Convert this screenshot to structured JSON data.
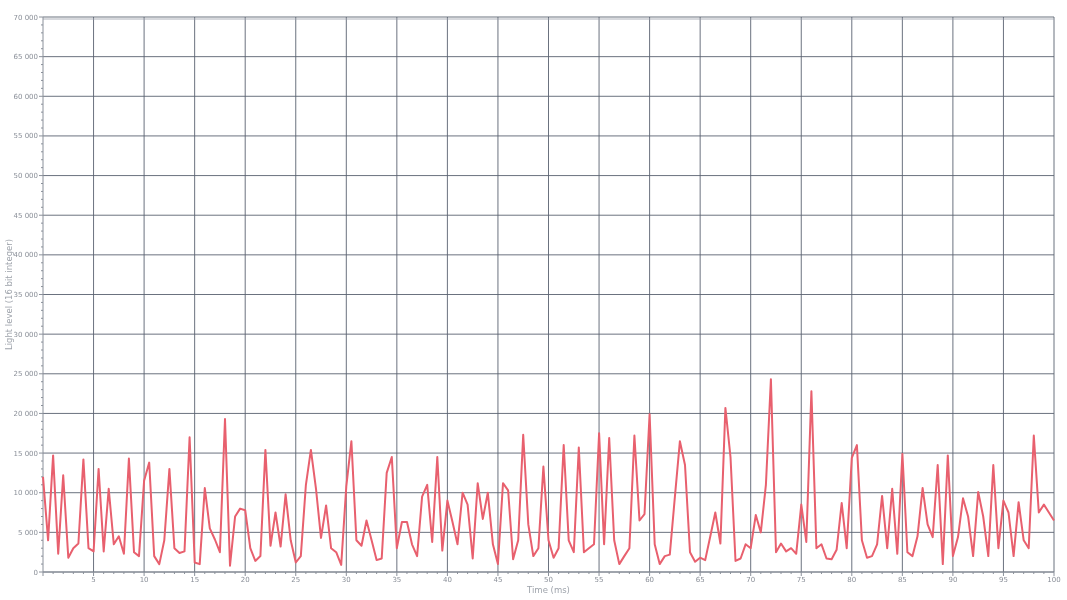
{
  "chart": {
    "chart_data": {
      "type": "line",
      "xlabel": "Time (ms)",
      "ylabel": "Light level (16 bit integer)",
      "xlim": [
        0,
        100
      ],
      "ylim": [
        0,
        70000
      ],
      "xticks": [
        5,
        10,
        15,
        20,
        25,
        30,
        35,
        40,
        45,
        50,
        55,
        60,
        65,
        70,
        75,
        80,
        85,
        90,
        95,
        100
      ],
      "yticks": [
        {
          "value": 0,
          "label": "0"
        },
        {
          "value": 5000,
          "label": "5 000"
        },
        {
          "value": 10000,
          "label": "10 000"
        },
        {
          "value": 15000,
          "label": "15 000"
        },
        {
          "value": 20000,
          "label": "20 000"
        },
        {
          "value": 25000,
          "label": "25 000"
        },
        {
          "value": 30000,
          "label": "30 000"
        },
        {
          "value": 35000,
          "label": "35 000"
        },
        {
          "value": 40000,
          "label": "40 000"
        },
        {
          "value": 45000,
          "label": "45 000"
        },
        {
          "value": 50000,
          "label": "50 000"
        },
        {
          "value": 55000,
          "label": "55 000"
        },
        {
          "value": 60000,
          "label": "60 000"
        },
        {
          "value": 65000,
          "label": "65 000"
        },
        {
          "value": 70000,
          "label": "70 000"
        }
      ],
      "x": [
        0,
        0.5,
        1,
        1.5,
        2,
        2.5,
        3,
        3.5,
        4,
        4.5,
        5,
        5.5,
        6,
        6.5,
        7,
        7.5,
        8,
        8.5,
        9,
        9.5,
        10,
        10.5,
        11,
        11.5,
        12,
        12.5,
        13,
        13.5,
        14,
        14.5,
        15,
        15.5,
        16,
        16.5,
        17,
        17.5,
        18,
        18.5,
        19,
        19.5,
        20,
        20.5,
        21,
        21.5,
        22,
        22.5,
        23,
        23.5,
        24,
        24.5,
        25,
        25.5,
        26,
        26.5,
        27,
        27.5,
        28,
        28.5,
        29,
        29.5,
        30,
        30.5,
        31,
        31.5,
        32,
        32.5,
        33,
        33.5,
        34,
        34.5,
        35,
        35.5,
        36,
        36.5,
        37,
        37.5,
        38,
        38.5,
        39,
        39.5,
        40,
        40.5,
        41,
        41.5,
        42,
        42.5,
        43,
        43.5,
        44,
        44.5,
        45,
        45.5,
        46,
        46.5,
        47,
        47.5,
        48,
        48.5,
        49,
        49.5,
        50,
        50.5,
        51,
        51.5,
        52,
        52.5,
        53,
        53.5,
        54,
        54.5,
        55,
        55.5,
        56,
        56.5,
        57,
        57.5,
        58,
        58.5,
        59,
        59.5,
        60,
        60.5,
        61,
        61.5,
        62,
        62.5,
        63,
        63.5,
        64,
        64.5,
        65,
        65.5,
        66,
        66.5,
        67,
        67.5,
        68,
        68.5,
        69,
        69.5,
        70,
        70.5,
        71,
        71.5,
        72,
        72.5,
        73,
        73.5,
        74,
        74.5,
        75,
        75.5,
        76,
        76.5,
        77,
        77.5,
        78,
        78.5,
        79,
        79.5,
        80,
        80.5,
        81,
        81.5,
        82,
        82.5,
        83,
        83.5,
        84,
        84.5,
        85,
        85.5,
        86,
        86.5,
        87,
        87.5,
        88,
        88.5,
        89,
        89.5,
        90,
        90.5,
        91,
        91.5,
        92,
        92.5,
        93,
        93.5,
        94,
        94.5,
        95,
        95.5,
        96,
        96.5,
        97,
        97.5,
        98,
        98.5,
        99,
        99.5,
        100
      ],
      "grid": true,
      "series": [
        {
          "color": "#e8606e",
          "values": [
            12000,
            4000,
            14700,
            2300,
            12200,
            1800,
            3000,
            3600,
            14200,
            3000,
            2600,
            13000,
            2600,
            10500,
            3500,
            4500,
            2300,
            14300,
            2500,
            2000,
            11500,
            13800,
            2000,
            1000,
            4000,
            13000,
            3000,
            2400,
            2600,
            17000,
            1200,
            1000,
            10600,
            5500,
            4100,
            2500,
            19300,
            800,
            7000,
            8000,
            7800,
            3000,
            1400,
            2000,
            15400,
            3300,
            7500,
            3200,
            9800,
            4000,
            1200,
            2000,
            11000,
            15400,
            10500,
            4300,
            8400,
            3000,
            2500,
            900,
            10800,
            16500,
            4000,
            3300,
            6500,
            4000,
            1500,
            1700,
            12500,
            14500,
            3000,
            6300,
            6300,
            3500,
            2000,
            9500,
            11000,
            3800,
            14500,
            2700,
            9000,
            6300,
            3500,
            10000,
            8500,
            1700,
            11200,
            6700,
            10000,
            3500,
            1000,
            11200,
            10300,
            1600,
            4000,
            17300,
            6000,
            2000,
            3000,
            13300,
            4000,
            1800,
            3000,
            16000,
            4000,
            2500,
            15700,
            2500,
            3000,
            3500,
            17500,
            3500,
            16900,
            4000,
            1000,
            2000,
            3000,
            17200,
            6500,
            7300,
            19900,
            3500,
            1000,
            2000,
            2200,
            9500,
            16500,
            13500,
            2500,
            1300,
            1800,
            1500,
            4500,
            7500,
            3600,
            20700,
            14500,
            1400,
            1700,
            3500,
            3000,
            7200,
            5000,
            11000,
            24300,
            2500,
            3600,
            2600,
            3000,
            2300,
            8500,
            3800,
            22800,
            3000,
            3500,
            1700,
            1600,
            2800,
            8700,
            3000,
            14400,
            16000,
            4000,
            1800,
            2000,
            3500,
            9600,
            3000,
            10500,
            2300,
            14900,
            2500,
            2000,
            4500,
            10600,
            6000,
            4400,
            13500,
            1000,
            14700,
            2000,
            4400,
            9300,
            7000,
            2000,
            10100,
            7000,
            2000,
            13500,
            3000,
            9000,
            7500,
            2000,
            8800,
            4000,
            3000,
            17200,
            7500,
            8500,
            7500,
            6500
          ]
        }
      ]
    }
  }
}
